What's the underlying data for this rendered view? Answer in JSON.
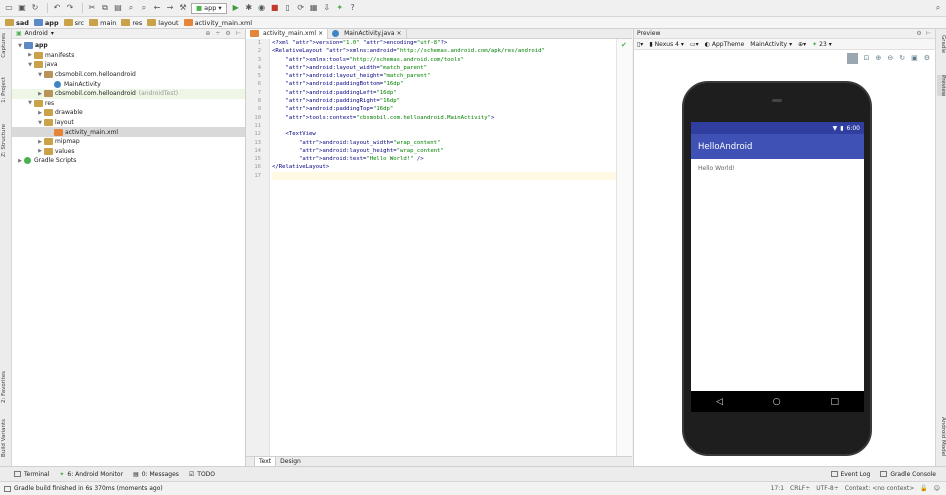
{
  "toolbar": {
    "run_config": "app"
  },
  "breadcrumbs": [
    "sad",
    "app",
    "src",
    "main",
    "res",
    "layout",
    "activity_main.xml"
  ],
  "left_strip": [
    "1: Project",
    "Captures",
    "Z: Structure",
    "2: Favorites",
    "Build Variants"
  ],
  "project": {
    "view_mode": "Android",
    "tree": [
      {
        "label": "app",
        "depth": 0,
        "icon": "folder"
      },
      {
        "label": "manifests",
        "depth": 1,
        "icon": "folder"
      },
      {
        "label": "java",
        "depth": 1,
        "icon": "folder"
      },
      {
        "label": "cbsmobil.com.helloandroid",
        "depth": 2,
        "icon": "package"
      },
      {
        "label": "MainActivity",
        "depth": 3,
        "icon": "class"
      },
      {
        "label": "cbsmobil.com.helloandroid",
        "suffix": "(androidTest)",
        "depth": 2,
        "icon": "package"
      },
      {
        "label": "res",
        "depth": 1,
        "icon": "folder"
      },
      {
        "label": "drawable",
        "depth": 2,
        "icon": "folder"
      },
      {
        "label": "layout",
        "depth": 2,
        "icon": "folder"
      },
      {
        "label": "activity_main.xml",
        "depth": 3,
        "icon": "xml"
      },
      {
        "label": "mipmap",
        "depth": 2,
        "icon": "folder"
      },
      {
        "label": "values",
        "depth": 2,
        "icon": "folder"
      },
      {
        "label": "Gradle Scripts",
        "depth": 0,
        "icon": "gradle"
      }
    ]
  },
  "editor": {
    "tabs": [
      "activity_main.xml",
      "MainActivity.java"
    ],
    "lines": [
      "<?xml version=\"1.0\" encoding=\"utf-8\"?>",
      "<RelativeLayout xmlns:android=\"http://schemas.android.com/apk/res/android\"",
      "    xmlns:tools=\"http://schemas.android.com/tools\"",
      "    android:layout_width=\"match_parent\"",
      "    android:layout_height=\"match_parent\"",
      "    android:paddingBottom=\"16dp\"",
      "    android:paddingLeft=\"16dp\"",
      "    android:paddingRight=\"16dp\"",
      "    android:paddingTop=\"16dp\"",
      "    tools:context=\"cbsmobil.com.helloandroid.MainActivity\">",
      "",
      "    <TextView",
      "        android:layout_width=\"wrap_content\"",
      "        android:layout_height=\"wrap_content\"",
      "        android:text=\"Hello World!\" />",
      "</RelativeLayout>",
      ""
    ],
    "bottom_tabs": [
      "Text",
      "Design"
    ]
  },
  "preview": {
    "title": "Preview",
    "device": "Nexus 4",
    "theme": "AppTheme",
    "activity": "MainActivity",
    "api": "23",
    "phone": {
      "time": "6:00",
      "app_title": "HelloAndroid",
      "body_text": "Hello World!"
    }
  },
  "right_strip": [
    "Gradle",
    "Preview",
    "Android Model"
  ],
  "bottom_tools": [
    "Terminal",
    "6: Android Monitor",
    "0: Messages",
    "TODO"
  ],
  "bottom_right_tools": [
    "Event Log",
    "Gradle Console"
  ],
  "status": {
    "message": "Gradle build finished in 6s 370ms (moments ago)",
    "position": "17:1",
    "line_sep": "CRLF÷",
    "encoding": "UTF-8÷",
    "context": "Context: <no context>"
  }
}
